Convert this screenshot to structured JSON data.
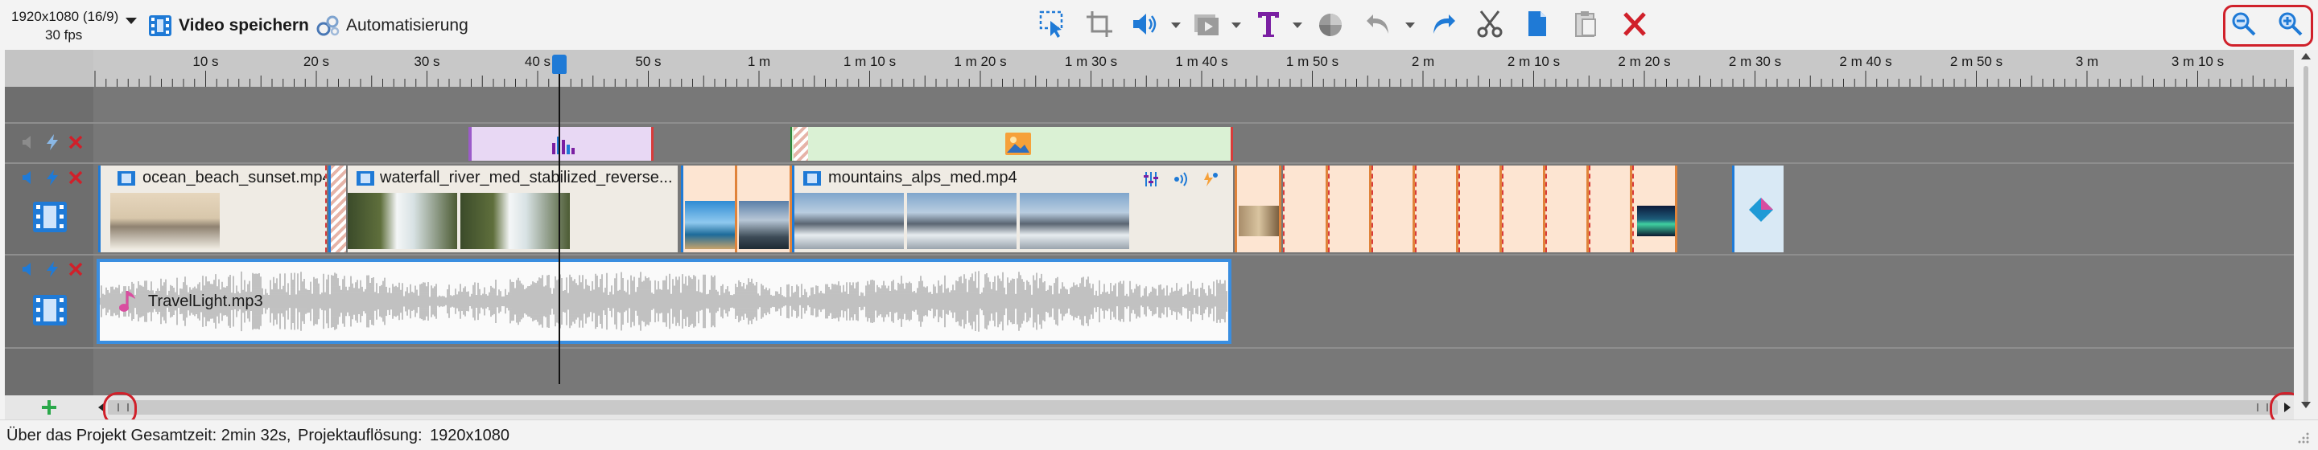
{
  "toolbar": {
    "resolution": "1920x1080 (16/9)",
    "fps": "30 fps",
    "save_label": "Video speichern",
    "automation_label": "Automatisierung",
    "icons": [
      "crop-select-icon",
      "crop-icon",
      "volume-icon",
      "media-icon",
      "text-icon",
      "color-icon",
      "undo-icon",
      "redo-icon",
      "cut-icon",
      "copy-icon",
      "paste-icon",
      "delete-icon",
      "zoom-out-icon",
      "zoom-in-icon"
    ],
    "accent": "#1f7ad6",
    "text_accent": "#7a1fa2",
    "delete_color": "#d0202a"
  },
  "ruler": {
    "labels": [
      "10 s",
      "20 s",
      "30 s",
      "40 s",
      "50 s",
      "1 m",
      "1 m 10 s",
      "1 m 20 s",
      "1 m 30 s",
      "1 m 40 s",
      "1 m 50 s",
      "2 m",
      "2 m 10 s",
      "2 m 20 s",
      "2 m 30 s",
      "2 m 40 s",
      "2 m 50 s",
      "3 m",
      "3 m 10 s"
    ]
  },
  "tracks": {
    "video": {
      "clips": {
        "beach": "ocean_beach_sunset.mp4",
        "waterfall": "waterfall_river_med_stabilized_reverse...",
        "mountains": "mountains_alps_med.mp4"
      }
    },
    "audio": {
      "clip": "TravelLight.mp3"
    }
  },
  "status": {
    "project_text": "Über das Projekt Gesamtzeit: 2min 32s,",
    "resolution_text": "Projektauflösung:",
    "resolution_value": "1920x1080"
  }
}
